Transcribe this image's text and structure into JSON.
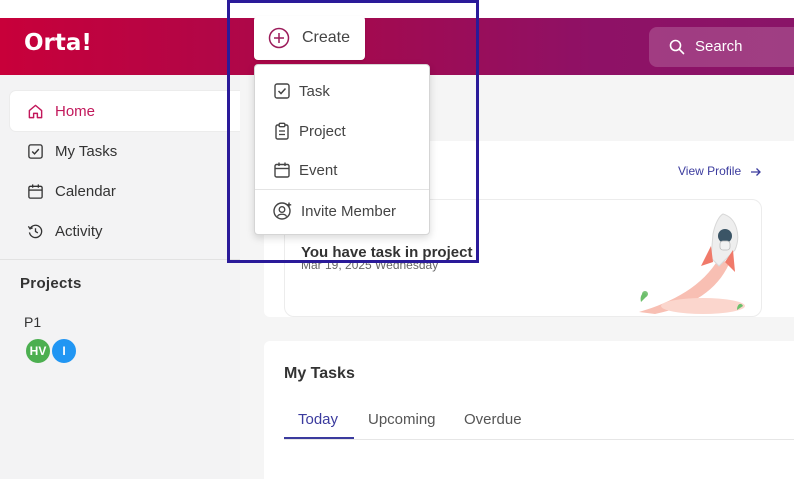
{
  "app": {
    "logo_text": "Orta!"
  },
  "header": {
    "search_label": "Search"
  },
  "create_menu": {
    "button_label": "Create",
    "items": [
      {
        "label": "Task",
        "icon": "checkbox-icon"
      },
      {
        "label": "Project",
        "icon": "clipboard-icon"
      },
      {
        "label": "Event",
        "icon": "calendar-icon"
      },
      {
        "label": "Invite Member",
        "icon": "user-plus-icon"
      }
    ]
  },
  "sidebar": {
    "items": [
      {
        "label": "Home",
        "icon": "home-icon",
        "active": true
      },
      {
        "label": "My Tasks",
        "icon": "checkbox-icon"
      },
      {
        "label": "Calendar",
        "icon": "calendar-icon"
      },
      {
        "label": "Activity",
        "icon": "history-icon"
      }
    ],
    "projects_title": "Projects",
    "projects": [
      {
        "name": "P1",
        "members": [
          {
            "initials": "HV",
            "color": "#4caf50"
          },
          {
            "initials": "I",
            "color": "#2196f3"
          }
        ]
      }
    ]
  },
  "profile_card": {
    "view_profile": "View Profile",
    "task_heading": "You have task in project",
    "date": "Mar 19, 2025 Wednesday"
  },
  "my_tasks": {
    "title": "My Tasks",
    "tabs": [
      {
        "label": "Today",
        "active": true
      },
      {
        "label": "Upcoming"
      },
      {
        "label": "Overdue"
      }
    ]
  },
  "colors": {
    "brand": "#c8003a",
    "accent": "#3b3b9e",
    "highlight": "#2a1a99"
  }
}
